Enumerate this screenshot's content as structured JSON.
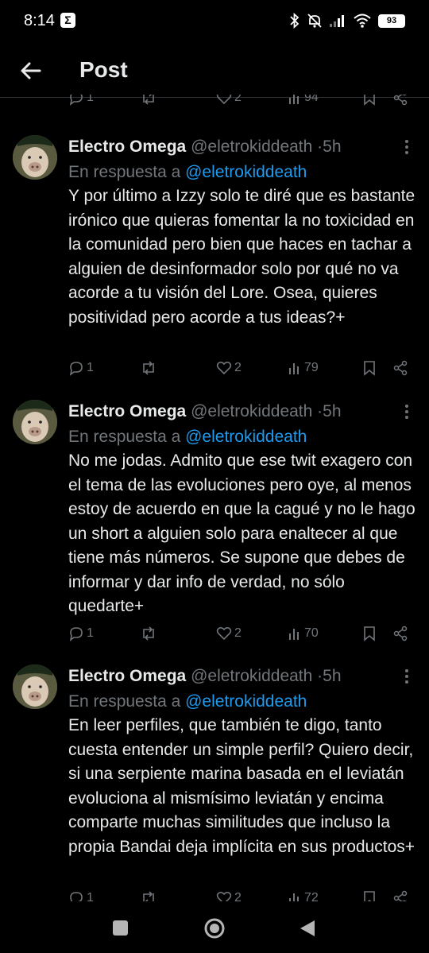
{
  "status_bar": {
    "time": "8:14",
    "notification_glyph": "Σ",
    "battery": "93"
  },
  "header": {
    "title": "Post"
  },
  "colors": {
    "background": "#000000",
    "text": "#e7e9ea",
    "secondary": "#71767b",
    "accent": "#1d9bf0"
  },
  "top_partial_actions": {
    "replies": "1",
    "likes": "2",
    "views": "94"
  },
  "tweets": [
    {
      "name": "Electro Omega",
      "handle": "@eletrokiddeath",
      "separator": "·",
      "time": "5h",
      "reply_prefix": "En respuesta a",
      "reply_to": "@eletrokiddeath",
      "text": "Y por último a Izzy solo te diré que es bastante irónico que quieras fomentar la no toxicidad en la comunidad pero bien que haces en tachar a alguien de desinformador solo por qué no va acorde a tu visión del Lore. Osea, quieres positividad pero acorde a tus ideas?+",
      "replies": "1",
      "likes": "2",
      "views": "79"
    },
    {
      "name": "Electro Omega",
      "handle": "@eletrokiddeath",
      "separator": "·",
      "time": "5h",
      "reply_prefix": "En respuesta a",
      "reply_to": "@eletrokiddeath",
      "text": "No me jodas. Admito que ese twit exagero con el tema de las evoluciones pero oye, al menos estoy de acuerdo en que la cagué y no le hago un short a alguien solo para enaltecer al que tiene más números. Se supone que debes de informar y dar info de verdad, no sólo quedarte+",
      "replies": "1",
      "likes": "2",
      "views": "70"
    },
    {
      "name": "Electro Omega",
      "handle": "@eletrokiddeath",
      "separator": "·",
      "time": "5h",
      "reply_prefix": "En respuesta a",
      "reply_to": "@eletrokiddeath",
      "text": "En leer perfiles, que también te digo, tanto cuesta entender un simple perfil? Quiero decir, si una serpiente marina basada en el leviatán evoluciona al mismísimo leviatán y encima comparte muchas similitudes que incluso la propia Bandai deja implícita en sus productos+",
      "replies": "1",
      "likes": "2",
      "views": "72"
    }
  ]
}
